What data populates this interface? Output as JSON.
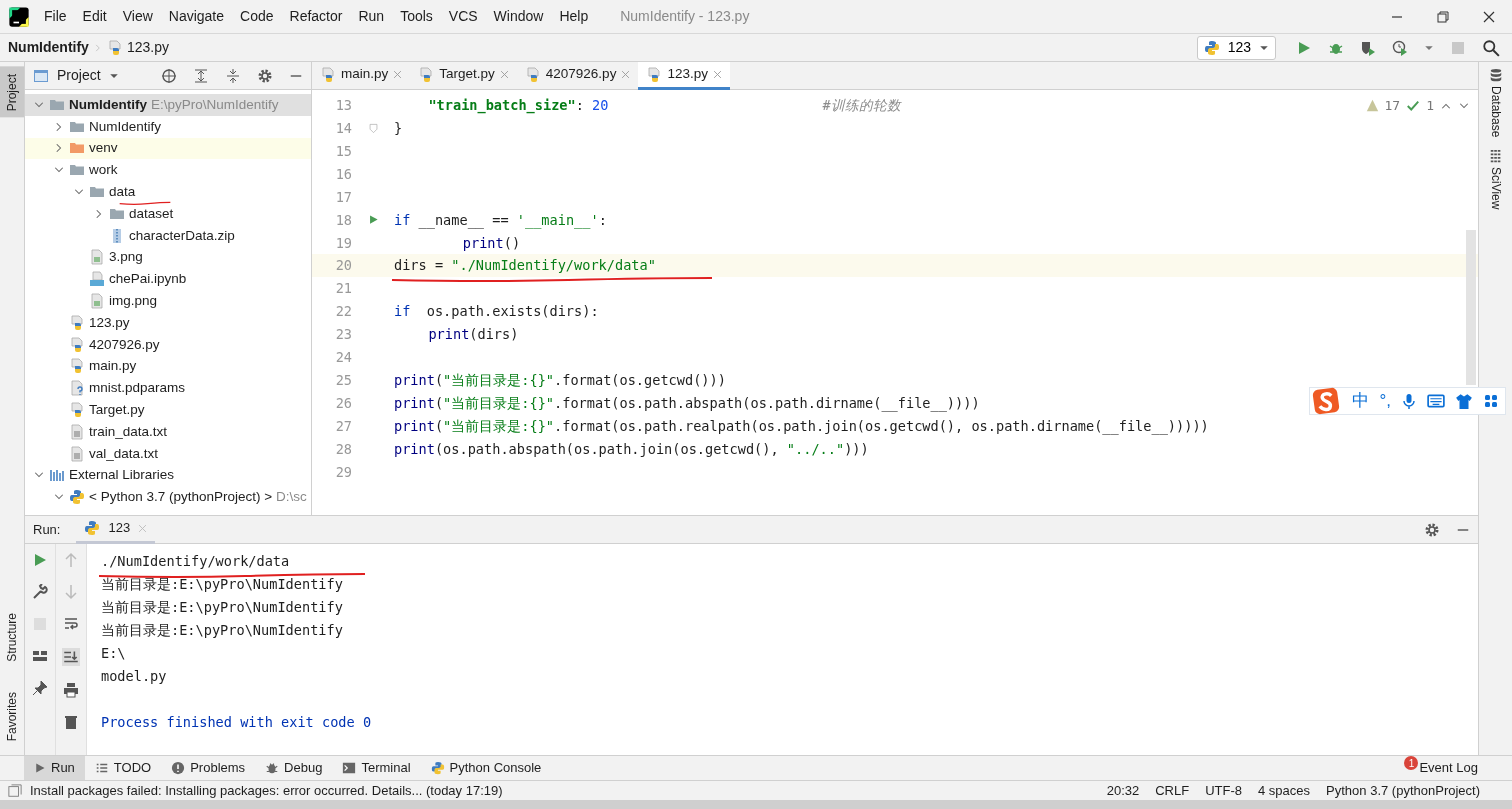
{
  "window": {
    "title": "NumIdentify - 123.py",
    "menu": [
      "File",
      "Edit",
      "View",
      "Navigate",
      "Code",
      "Refactor",
      "Run",
      "Tools",
      "VCS",
      "Window",
      "Help"
    ]
  },
  "breadcrumb": {
    "project": "NumIdentify",
    "file": "123.py"
  },
  "run_config": {
    "label": "123"
  },
  "left_strip": [
    {
      "label": "Project",
      "selected": true
    },
    {
      "label": "Structure",
      "selected": false
    },
    {
      "label": "Favorites",
      "selected": false
    }
  ],
  "right_strip": [
    {
      "label": "Database"
    },
    {
      "label": "SciView"
    }
  ],
  "project_panel": {
    "title": "Project",
    "tree": [
      {
        "label": "NumIdentify",
        "note": "E:\\pyPro\\NumIdentify",
        "kind": "folder",
        "selected": true,
        "expanded": true,
        "children": [
          {
            "label": "NumIdentify",
            "kind": "folder",
            "selected": false,
            "expanded": false
          },
          {
            "label": "venv",
            "kind": "excluded",
            "selected": false,
            "expanded": false
          },
          {
            "label": "work",
            "kind": "folder",
            "selected": false,
            "expanded": true,
            "children": [
              {
                "label": "data",
                "kind": "folder",
                "selected": false,
                "expanded": true,
                "underlined": true,
                "children": [
                  {
                    "label": "dataset",
                    "kind": "folder",
                    "selected": false,
                    "expanded": false
                  },
                  {
                    "label": "characterData.zip",
                    "kind": "zip",
                    "selected": false
                  }
                ]
              },
              {
                "label": "3.png",
                "kind": "image",
                "selected": false
              },
              {
                "label": "chePai.ipynb",
                "kind": "notebook",
                "selected": false
              },
              {
                "label": "img.png",
                "kind": "image",
                "selected": false
              }
            ]
          },
          {
            "label": "123.py",
            "kind": "python",
            "selected": false
          },
          {
            "label": "4207926.py",
            "kind": "python",
            "selected": false
          },
          {
            "label": "main.py",
            "kind": "python",
            "selected": false
          },
          {
            "label": "mnist.pdparams",
            "kind": "unknown",
            "selected": false
          },
          {
            "label": "Target.py",
            "kind": "python",
            "selected": false
          },
          {
            "label": "train_data.txt",
            "kind": "text",
            "selected": false
          },
          {
            "label": "val_data.txt",
            "kind": "text",
            "selected": false
          }
        ]
      },
      {
        "label": "External Libraries",
        "kind": "library",
        "selected": false,
        "expanded": true,
        "children": [
          {
            "label": "< Python 3.7 (pythonProject) >",
            "note": "D:\\sc",
            "kind": "sdk",
            "selected": false,
            "expanded": true
          }
        ]
      }
    ]
  },
  "editor": {
    "tabs": [
      {
        "label": "main.py",
        "selected": false
      },
      {
        "label": "Target.py",
        "selected": false
      },
      {
        "label": "4207926.py",
        "selected": false
      },
      {
        "label": "123.py",
        "selected": true
      }
    ],
    "inspections": {
      "warnings": "17",
      "weak_warnings": "1"
    },
    "lines": [
      {
        "number": "13",
        "current": false,
        "kind": "inner",
        "tokens": [
          {
            "kind": "key",
            "text": "\"train_batch_size\""
          },
          {
            "kind": "plain",
            "text": ": "
          },
          {
            "kind": "num",
            "text": "20"
          },
          {
            "kind": "comment",
            "text": "#训练的轮数"
          }
        ]
      },
      {
        "number": "14",
        "current": false,
        "foldable": true,
        "kind": "top",
        "tokens": [
          {
            "kind": "plain",
            "text": "}"
          }
        ]
      },
      {
        "number": "15",
        "current": false
      },
      {
        "number": "16",
        "current": false
      },
      {
        "number": "17",
        "current": false
      },
      {
        "number": "18",
        "current": false,
        "runnable": true,
        "kind": "top",
        "tokens": [
          {
            "kind": "kw",
            "text": "if"
          },
          {
            "kind": "plain",
            "text": " __name__ == "
          },
          {
            "kind": "str",
            "text": "'__main__'"
          },
          {
            "kind": "plain",
            "text": ":"
          }
        ]
      },
      {
        "number": "19",
        "current": false,
        "kind": "deep",
        "tokens": [
          {
            "kind": "builtin",
            "text": "print"
          },
          {
            "kind": "plain",
            "text": "()"
          }
        ]
      },
      {
        "number": "20",
        "current": true,
        "kind": "top",
        "underlined": true,
        "tokens": [
          {
            "kind": "plain",
            "text": "dirs = "
          },
          {
            "kind": "str",
            "text": "\"./NumIdentify/work/data\""
          }
        ]
      },
      {
        "number": "21",
        "current": false
      },
      {
        "number": "22",
        "current": false,
        "kind": "top",
        "tokens": [
          {
            "kind": "kw",
            "text": "if"
          },
          {
            "kind": "plain",
            "text": "  os.path.exists(dirs):"
          }
        ]
      },
      {
        "number": "23",
        "current": false,
        "kind": "inner",
        "tokens": [
          {
            "kind": "builtin",
            "text": "print"
          },
          {
            "kind": "plain",
            "text": "(dirs)"
          }
        ]
      },
      {
        "number": "24",
        "current": false
      },
      {
        "number": "25",
        "current": false,
        "kind": "top",
        "tokens": [
          {
            "kind": "builtin",
            "text": "print"
          },
          {
            "kind": "plain",
            "text": "("
          },
          {
            "kind": "str",
            "text": "\"当前目录是:{}\""
          },
          {
            "kind": "plain",
            "text": ".format(os.getcwd()))"
          }
        ]
      },
      {
        "number": "26",
        "current": false,
        "kind": "top",
        "tokens": [
          {
            "kind": "builtin",
            "text": "print"
          },
          {
            "kind": "plain",
            "text": "("
          },
          {
            "kind": "str",
            "text": "\"当前目录是:{}\""
          },
          {
            "kind": "plain",
            "text": ".format(os.path.abspath(os.path.dirname(__file__))))"
          }
        ]
      },
      {
        "number": "27",
        "current": false,
        "kind": "top",
        "tokens": [
          {
            "kind": "builtin",
            "text": "print"
          },
          {
            "kind": "plain",
            "text": "("
          },
          {
            "kind": "str",
            "text": "\"当前目录是:{}\""
          },
          {
            "kind": "plain",
            "text": ".format(os.path.realpath(os.path.join(os.getcwd(), os.path.dirname(__file__)))))"
          }
        ]
      },
      {
        "number": "28",
        "current": false,
        "kind": "top",
        "tokens": [
          {
            "kind": "builtin",
            "text": "print"
          },
          {
            "kind": "plain",
            "text": "(os.path.abspath(os.path.join(os.getcwd(), "
          },
          {
            "kind": "str",
            "text": "\"../..\""
          },
          {
            "kind": "plain",
            "text": ")))"
          }
        ]
      },
      {
        "number": "29",
        "current": false
      }
    ]
  },
  "ime_bar": {
    "mode": "中",
    "punctuation": "°,"
  },
  "run_panel": {
    "title": "Run:",
    "tab": "123",
    "output": [
      {
        "text": "./NumIdentify/work/data",
        "kind": "stdout",
        "underlined": true
      },
      {
        "text": "当前目录是:E:\\pyPro\\NumIdentify",
        "kind": "stdout",
        "underlined": false
      },
      {
        "text": "当前目录是:E:\\pyPro\\NumIdentify",
        "kind": "stdout",
        "underlined": false
      },
      {
        "text": "当前目录是:E:\\pyPro\\NumIdentify",
        "kind": "stdout",
        "underlined": false
      },
      {
        "text": "E:\\",
        "kind": "stdout",
        "underlined": false
      },
      {
        "text": "model.py",
        "kind": "stdout",
        "underlined": false
      },
      {
        "text": "Process finished with exit code 0",
        "kind": "system",
        "underlined": false
      }
    ]
  },
  "tool_tabs": [
    {
      "label": "Run",
      "selected": true
    },
    {
      "label": "TODO",
      "selected": false
    },
    {
      "label": "Problems",
      "selected": false
    },
    {
      "label": "Debug",
      "selected": false
    },
    {
      "label": "Terminal",
      "selected": false
    },
    {
      "label": "Python Console",
      "selected": false
    }
  ],
  "event_log": {
    "label": "Event Log",
    "count": "1"
  },
  "status_bar": {
    "message": "Install packages failed: Installing packages: error occurred. Details... (today 17:19)",
    "items": [
      "20:32",
      "CRLF",
      "UTF-8",
      "4 spaces",
      "Python 3.7 (pythonProject)"
    ]
  }
}
